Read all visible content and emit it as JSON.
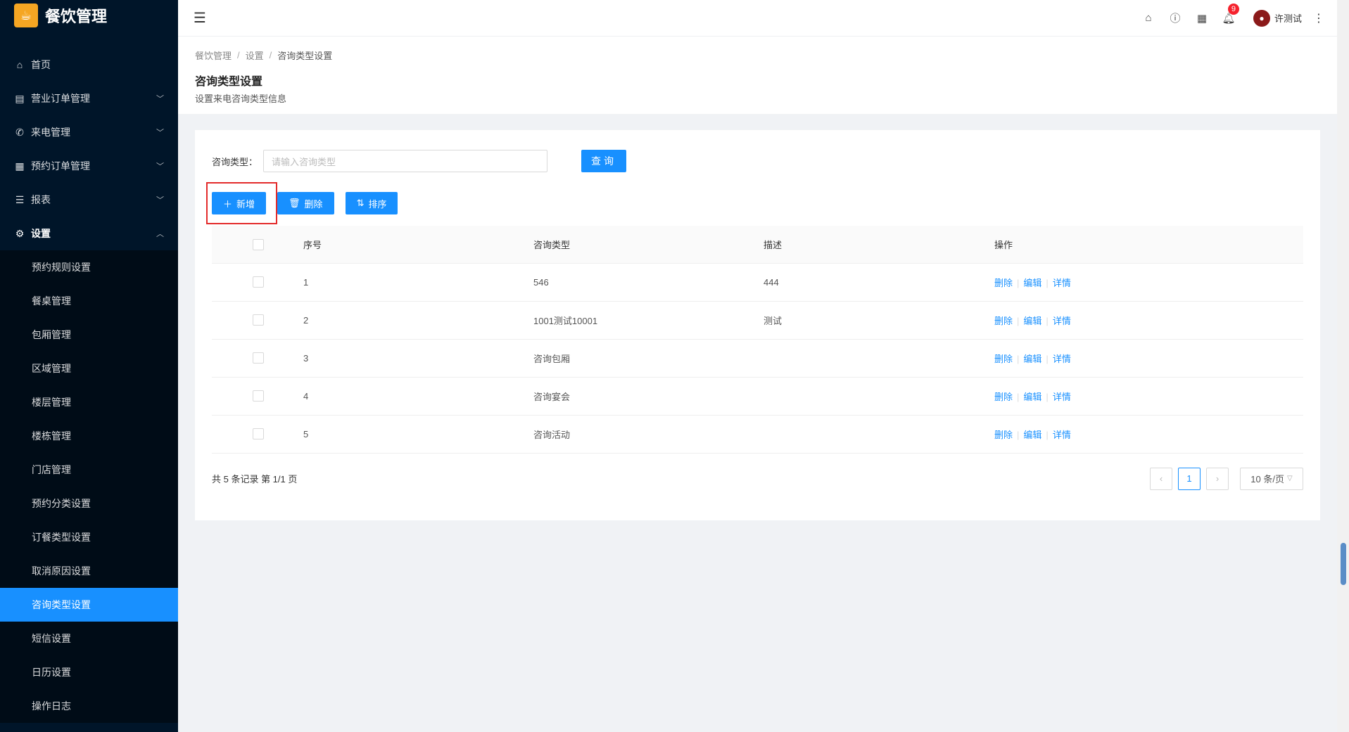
{
  "app": {
    "title": "餐饮管理"
  },
  "sidebar": {
    "items": [
      {
        "icon": "home-icon",
        "glyph": "⌂",
        "label": "首页",
        "has_arrow": false
      },
      {
        "icon": "chart-icon",
        "glyph": "▤",
        "label": "营业订单管理",
        "has_arrow": true
      },
      {
        "icon": "phone-icon",
        "glyph": "✆",
        "label": "来电管理",
        "has_arrow": true
      },
      {
        "icon": "order-icon",
        "glyph": "▦",
        "label": "预约订单管理",
        "has_arrow": true
      },
      {
        "icon": "list-icon",
        "glyph": "☰",
        "label": "报表",
        "has_arrow": true
      },
      {
        "icon": "gear-icon",
        "glyph": "⚙",
        "label": "设置",
        "has_arrow": true,
        "open": true
      }
    ],
    "settings_sub": [
      "预约规则设置",
      "餐桌管理",
      "包厢管理",
      "区域管理",
      "楼层管理",
      "楼栋管理",
      "门店管理",
      "预约分类设置",
      "订餐类型设置",
      "取消原因设置",
      "咨询类型设置",
      "短信设置",
      "日历设置",
      "操作日志"
    ],
    "active_sub": "咨询类型设置"
  },
  "header": {
    "notification_count": "9",
    "username": "许测试"
  },
  "breadcrumb": [
    "餐饮管理",
    "设置",
    "咨询类型设置"
  ],
  "page": {
    "title": "咨询类型设置",
    "description": "设置来电咨询类型信息"
  },
  "search": {
    "label": "咨询类型：",
    "placeholder": "请输入咨询类型",
    "button": "查询"
  },
  "actions": {
    "add": "新增",
    "delete": "删除",
    "sort": "排序"
  },
  "table": {
    "headers": {
      "seq": "序号",
      "type": "咨询类型",
      "desc": "描述",
      "ops": "操作"
    },
    "rows": [
      {
        "seq": "1",
        "type": "546",
        "desc": "444"
      },
      {
        "seq": "2",
        "type": "1001测试10001",
        "desc": "测试"
      },
      {
        "seq": "3",
        "type": "咨询包厢",
        "desc": ""
      },
      {
        "seq": "4",
        "type": "咨询宴会",
        "desc": ""
      },
      {
        "seq": "5",
        "type": "咨询活动",
        "desc": ""
      }
    ],
    "op_labels": {
      "delete": "删除",
      "edit": "编辑",
      "detail": "详情"
    }
  },
  "pagination": {
    "total_text": "共 5 条记录 第 1/1 页",
    "current_page": "1",
    "page_size": "10 条/页"
  }
}
